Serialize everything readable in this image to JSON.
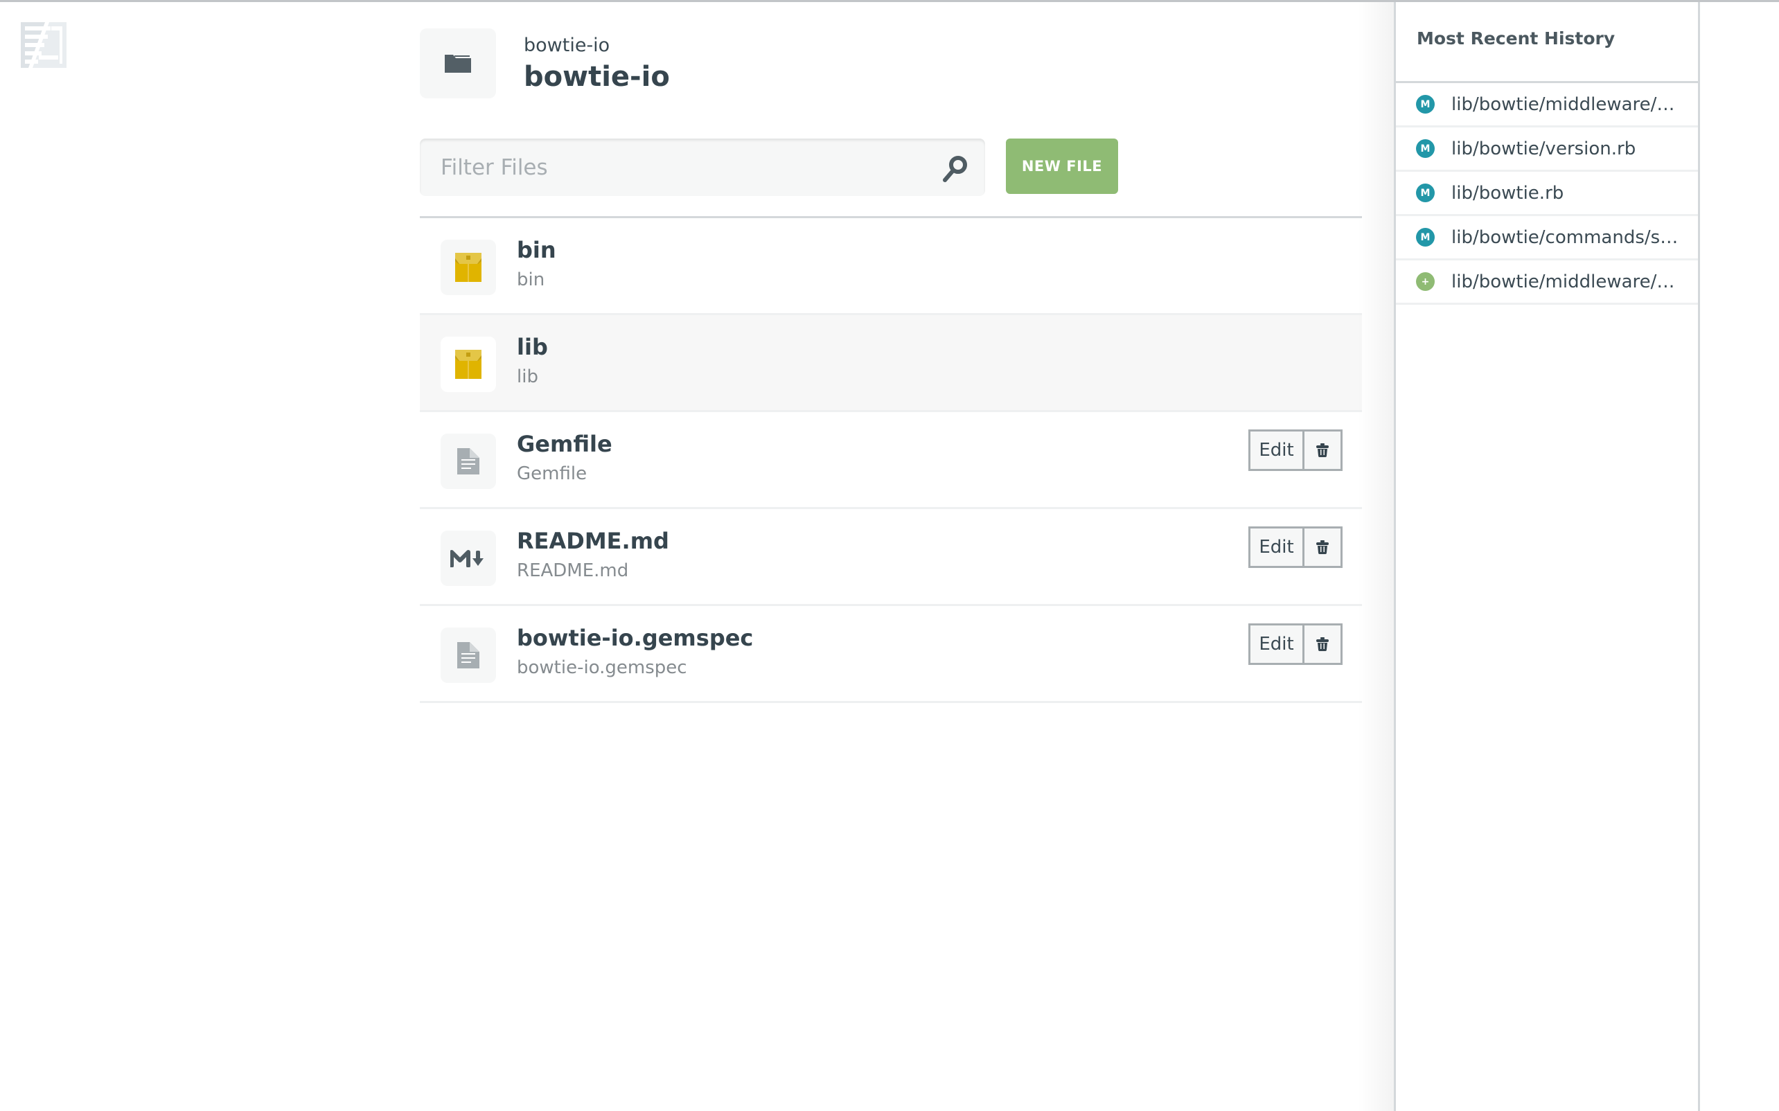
{
  "colors": {
    "modified": "#2297a8",
    "added": "#8fbb74",
    "primary_button": "#8fbb74",
    "package_icon": "#e0b400",
    "text_dark": "#36454e"
  },
  "logo": {
    "icon": "app-logo-icon"
  },
  "header": {
    "icon": "folder-icon",
    "subtitle": "bowtie-io",
    "title": "bowtie-io"
  },
  "filter": {
    "placeholder": "Filter Files",
    "value": "",
    "icon": "search-icon"
  },
  "toolbar": {
    "new_file_label": "NEW FILE"
  },
  "files": [
    {
      "name": "bin",
      "path": "bin",
      "icon": "package-folder-icon",
      "type": "folder",
      "hover": false
    },
    {
      "name": "lib",
      "path": "lib",
      "icon": "package-folder-icon",
      "type": "folder",
      "hover": true
    },
    {
      "name": "Gemfile",
      "path": "Gemfile",
      "icon": "document-icon",
      "type": "file",
      "edit_label": "Edit",
      "delete_icon": "trash-icon"
    },
    {
      "name": "README.md",
      "path": "README.md",
      "icon": "markdown-icon",
      "type": "file",
      "edit_label": "Edit",
      "delete_icon": "trash-icon"
    },
    {
      "name": "bowtie-io.gemspec",
      "path": "bowtie-io.gemspec",
      "icon": "document-icon",
      "type": "file",
      "edit_label": "Edit",
      "delete_icon": "trash-icon"
    }
  ],
  "sidebar": {
    "title": "Most Recent History",
    "items": [
      {
        "label": "lib/bowtie/middleware/p...",
        "status": "modified",
        "badge": "M"
      },
      {
        "label": "lib/bowtie/version.rb",
        "status": "modified",
        "badge": "M"
      },
      {
        "label": "lib/bowtie.rb",
        "status": "modified",
        "badge": "M"
      },
      {
        "label": "lib/bowtie/commands/se...",
        "status": "modified",
        "badge": "M"
      },
      {
        "label": "lib/bowtie/middleware/n...",
        "status": "added",
        "badge": "+"
      }
    ]
  }
}
